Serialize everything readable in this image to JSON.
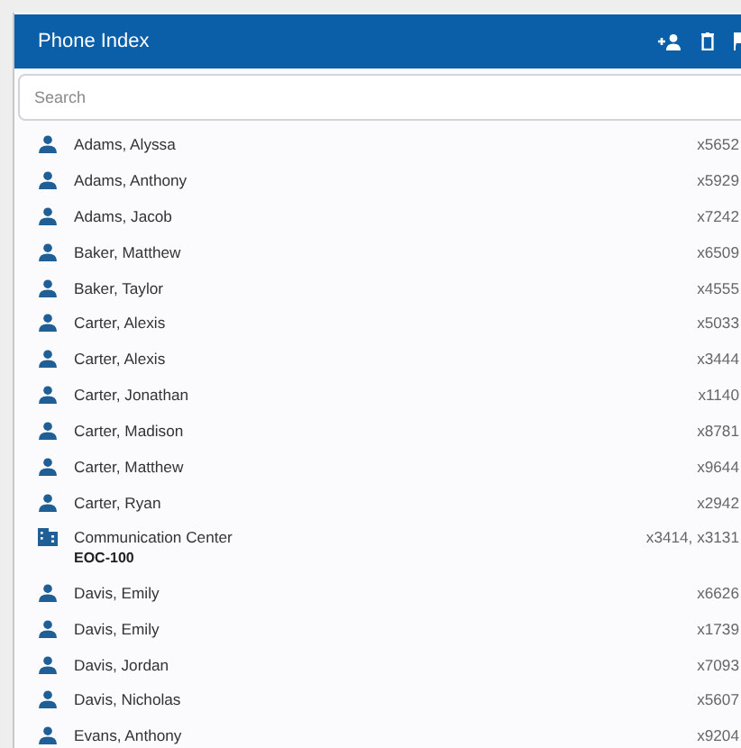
{
  "header": {
    "title": "Phone Index"
  },
  "search": {
    "placeholder": "Search"
  },
  "entries": [
    {
      "kind": "person",
      "name": "Adams, Alyssa",
      "extension": "x5652"
    },
    {
      "kind": "person",
      "name": "Adams, Anthony",
      "extension": "x5929"
    },
    {
      "kind": "person",
      "name": "Adams, Jacob",
      "extension": "x7242"
    },
    {
      "kind": "person",
      "name": "Baker, Matthew",
      "extension": "x6509"
    },
    {
      "kind": "person",
      "name": "Baker, Taylor",
      "extension": "x4555"
    },
    {
      "kind": "person",
      "name": "Carter, Alexis",
      "extension": "x5033"
    },
    {
      "kind": "person",
      "name": "Carter, Alexis",
      "extension": "x3444"
    },
    {
      "kind": "person",
      "name": "Carter, Jonathan",
      "extension": "x1140"
    },
    {
      "kind": "person",
      "name": "Carter, Madison",
      "extension": "x8781"
    },
    {
      "kind": "person",
      "name": "Carter, Matthew",
      "extension": "x9644"
    },
    {
      "kind": "person",
      "name": "Carter, Ryan",
      "extension": "x2942"
    },
    {
      "kind": "location",
      "name": "Communication Center",
      "subtitle": "EOC-100",
      "extension": "x3414, x3131"
    },
    {
      "kind": "person",
      "name": "Davis, Emily",
      "extension": "x6626"
    },
    {
      "kind": "person",
      "name": "Davis, Emily",
      "extension": "x1739"
    },
    {
      "kind": "person",
      "name": "Davis, Jordan",
      "extension": "x7093"
    },
    {
      "kind": "person",
      "name": "Davis, Nicholas",
      "extension": "x5607"
    },
    {
      "kind": "person",
      "name": "Evans, Anthony",
      "extension": "x9204"
    }
  ]
}
